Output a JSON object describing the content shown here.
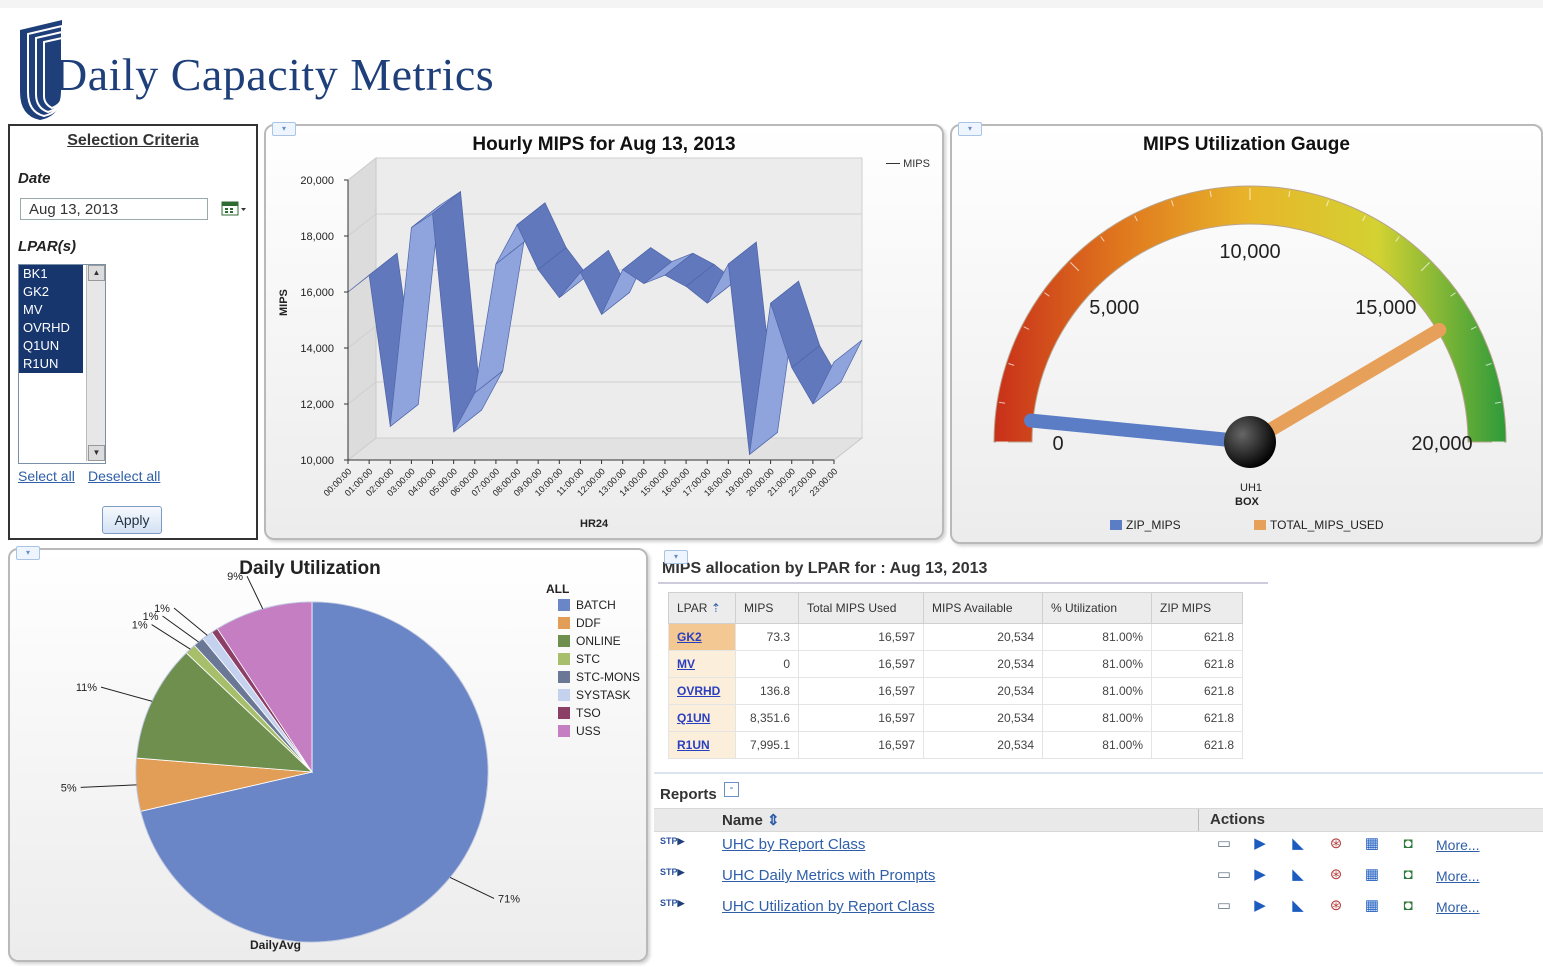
{
  "header": {
    "title": "Daily Capacity Metrics"
  },
  "selection": {
    "title": "Selection Criteria",
    "date_label": "Date",
    "date_value": "Aug 13, 2013",
    "lpar_label": "LPAR(s)",
    "lpars": [
      "BK1",
      "GK2",
      "MV",
      "OVRHD",
      "Q1UN",
      "R1UN"
    ],
    "select_all": "Select all",
    "deselect_all": "Deselect all",
    "apply": "Apply"
  },
  "charts": {
    "hourly": {
      "title": "Hourly MIPS for Aug 13, 2013",
      "legend": "MIPS",
      "xlabel": "HR24",
      "ylabel": "MIPS",
      "yticks": [
        "20,000",
        "18,000",
        "16,000",
        "14,000",
        "12,000",
        "10,000"
      ],
      "hours": [
        "00:00:00",
        "01:00:00",
        "02:00:00",
        "03:00:00",
        "04:00:00",
        "05:00:00",
        "06:00:00",
        "07:00:00",
        "08:00:00",
        "09:00:00",
        "10:00:00",
        "11:00:00",
        "12:00:00",
        "13:00:00",
        "14:00:00",
        "15:00:00",
        "16:00:00",
        "17:00:00",
        "18:00:00",
        "19:00:00",
        "20:00:00",
        "21:00:00",
        "22:00:00",
        "23:00:00"
      ]
    },
    "gauge": {
      "title": "MIPS Utilization Gauge",
      "ticks": [
        "0",
        "5,000",
        "10,000",
        "15,000",
        "20,000"
      ],
      "label_top": "UH1",
      "label_bottom": "BOX",
      "legend": [
        "ZIP_MIPS",
        "TOTAL_MIPS_USED"
      ]
    },
    "daily": {
      "title": "Daily Utilization",
      "xlabel": "DailyAvg",
      "legend_title": "ALL"
    }
  },
  "chart_data": [
    {
      "type": "line",
      "title": "Hourly MIPS for Aug 13, 2013",
      "xlabel": "HR24",
      "ylabel": "MIPS",
      "ylim": [
        10000,
        20000
      ],
      "categories": [
        "00:00:00",
        "01:00:00",
        "02:00:00",
        "03:00:00",
        "04:00:00",
        "05:00:00",
        "06:00:00",
        "07:00:00",
        "08:00:00",
        "09:00:00",
        "10:00:00",
        "11:00:00",
        "12:00:00",
        "13:00:00",
        "14:00:00",
        "15:00:00",
        "16:00:00",
        "17:00:00",
        "18:00:00",
        "19:00:00",
        "20:00:00",
        "21:00:00",
        "22:00:00",
        "23:00:00"
      ],
      "series": [
        {
          "name": "MIPS",
          "values": [
            16000,
            16600,
            11200,
            18300,
            18800,
            11000,
            12400,
            17000,
            18400,
            16800,
            15800,
            16700,
            15200,
            16800,
            16300,
            16600,
            16200,
            15600,
            17000,
            10200,
            15600,
            13300,
            12000,
            13500
          ]
        }
      ]
    },
    {
      "type": "gauge",
      "title": "MIPS Utilization Gauge",
      "min": 0,
      "max": 20000,
      "series": [
        {
          "name": "ZIP_MIPS",
          "value": 621.8,
          "color": "#5b7dc6"
        },
        {
          "name": "TOTAL_MIPS_USED",
          "value": 16597,
          "color": "#e6a05a"
        }
      ]
    },
    {
      "type": "pie",
      "title": "Daily Utilization",
      "xlabel": "DailyAvg",
      "slices": [
        {
          "name": "BATCH",
          "value": 71,
          "label": "71%",
          "color": "#6b86c6"
        },
        {
          "name": "DDF",
          "value": 5,
          "label": "5%",
          "color": "#e29d56"
        },
        {
          "name": "ONLINE",
          "value": 11,
          "label": "11%",
          "color": "#6f8f4e"
        },
        {
          "name": "STC",
          "value": 1,
          "label": "1%",
          "color": "#a7bf6b"
        },
        {
          "name": "STC-MONS",
          "value": 1,
          "label": "1%",
          "color": "#6a7896"
        },
        {
          "name": "SYSTASK",
          "value": 1,
          "label": "1%",
          "color": "#c4d2ef"
        },
        {
          "name": "TSO",
          "value": 0.6,
          "label": "",
          "color": "#8c3f66"
        },
        {
          "name": "USS",
          "value": 9,
          "label": "9%",
          "color": "#c57ec2"
        }
      ]
    }
  ],
  "mips_table": {
    "title": "MIPS allocation by LPAR for : Aug 13, 2013",
    "columns": [
      "LPAR",
      "MIPS",
      "Total MIPS Used",
      "MIPS Available",
      "% Utilization",
      "ZIP MIPS"
    ],
    "rows": [
      [
        "GK2",
        "73.3",
        "16,597",
        "20,534",
        "81.00%",
        "621.8"
      ],
      [
        "MV",
        "0",
        "16,597",
        "20,534",
        "81.00%",
        "621.8"
      ],
      [
        "OVRHD",
        "136.8",
        "16,597",
        "20,534",
        "81.00%",
        "621.8"
      ],
      [
        "Q1UN",
        "8,351.6",
        "16,597",
        "20,534",
        "81.00%",
        "621.8"
      ],
      [
        "R1UN",
        "7,995.1",
        "16,597",
        "20,534",
        "81.00%",
        "621.8"
      ]
    ]
  },
  "reports": {
    "label": "Reports",
    "toggle": "-",
    "col_name": "Name",
    "col_actions": "Actions",
    "more": "More...",
    "icon_text": "STP",
    "items": [
      "UHC by Report Class",
      "UHC Daily Metrics with Prompts",
      "UHC Utilization by Report Class"
    ]
  },
  "colors": {
    "title_blue": "#1e3f7a",
    "ribbon": "#6f86c8",
    "link": "#2f5fa8"
  }
}
